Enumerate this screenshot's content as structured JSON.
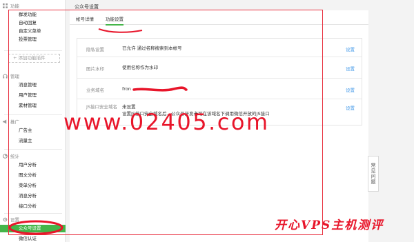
{
  "sidebar": {
    "sections": [
      {
        "title": "功能",
        "items": [
          "群发功能",
          "自动回复",
          "自定义菜单",
          "投票管理"
        ]
      },
      {
        "title": "管理",
        "items": [
          "消息管理",
          "用户管理",
          "素材管理"
        ]
      },
      {
        "title": "推广",
        "items": [
          "广告主",
          "流量主"
        ]
      },
      {
        "title": "统计",
        "items": [
          "用户分析",
          "图文分析",
          "菜单分析",
          "消息分析",
          "接口分析"
        ]
      },
      {
        "title": "设置",
        "items": [
          "公众号设置",
          "微信认证"
        ]
      }
    ],
    "add_plugin": "+ 添加功能插件",
    "active_item": "公众号设置"
  },
  "main": {
    "page_title": "公众号设置",
    "tabs": [
      "帐号详情",
      "功能设置"
    ],
    "active_tab": "功能设置",
    "rows": [
      {
        "label": "隐私设置",
        "value": "已允许 通过名称搜索到本帐号",
        "action": "设置"
      },
      {
        "label": "图片水印",
        "value": "使用名称作为水印",
        "action": "设置"
      },
      {
        "label": "业务域名",
        "value": "fron",
        "action": "设置"
      },
      {
        "label": "JS接口安全域名",
        "value": "未设置",
        "value2": "设置JS接口安全域名后，公众号开发者可在该域名下调用微信开放的JS接口",
        "action": "设置"
      }
    ],
    "feedback": "常见问题"
  },
  "watermarks": {
    "url": "www.02405.com",
    "site": "开心VPS主机测评"
  },
  "colors": {
    "accent_green": "#44b549",
    "link_blue": "#459ae9",
    "overlay_red": "#e8152a"
  }
}
